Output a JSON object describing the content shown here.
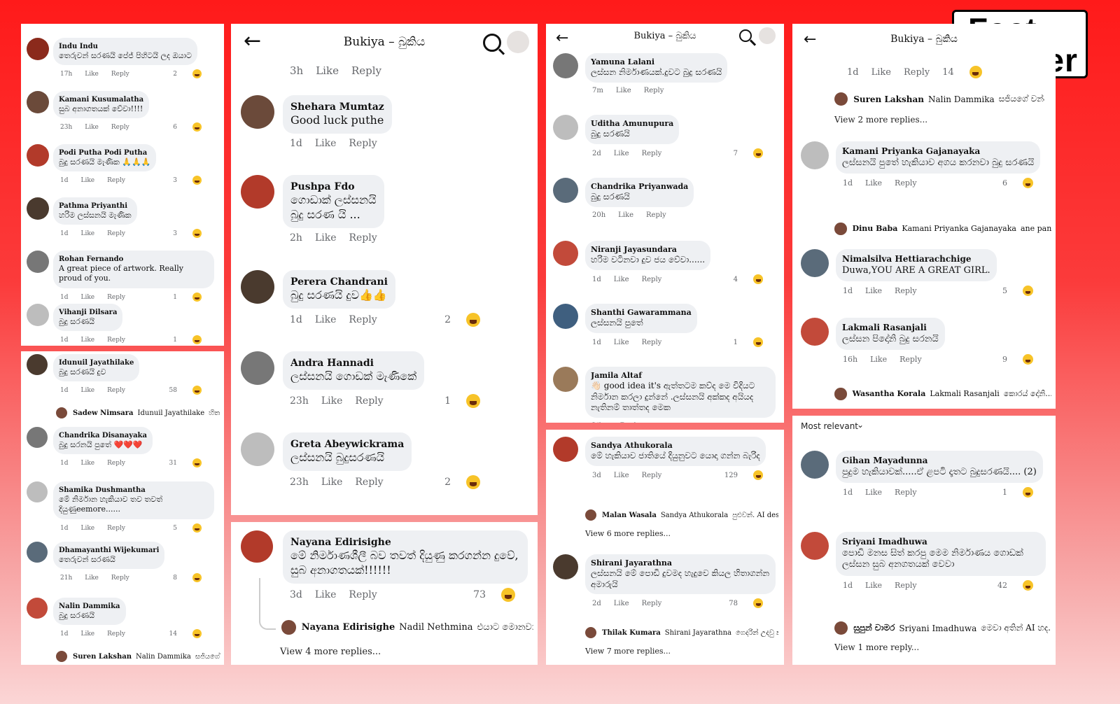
{
  "header_title": "Bukiya – බුකිය",
  "logo": {
    "line1": "Fact",
    "line2": "Seeker"
  },
  "meta": {
    "like": "Like",
    "reply": "Reply"
  },
  "p1": [
    {
      "name": "Indu Indu",
      "text": "තෙරුවන් සරණයි පේජ් පිහිටයි ලද ඔයාට",
      "time": "17h",
      "count": "2"
    },
    {
      "name": "Kamani Kusumalatha",
      "text": "සුබ අනාගතයක් වේවා!!!!",
      "time": "23h",
      "count": "6"
    },
    {
      "name": "Podi Putha Podi Putha",
      "text": "බුදු සරණයි මැණික 🙏🙏🙏",
      "time": "1d",
      "count": "3"
    },
    {
      "name": "Pathma Priyanthi",
      "text": "හරිම ලස්සනයි මැණික",
      "time": "1d",
      "count": "3"
    },
    {
      "name": "Rohan Fernando",
      "text": "A great piece of artwork. Really proud of you.",
      "time": "1d",
      "count": "1"
    },
    {
      "name": "Vihanji Dilsara",
      "text": "බුදු සරණයි",
      "time": "1d",
      "count": "1"
    }
  ],
  "p2": [
    {
      "name": "Idunuil Jayathilake",
      "text": "බුදු සරණයි දුව",
      "time": "1d",
      "count": "58",
      "reply": {
        "who": "Sadew Nimsara",
        "to": "Idunuil Jayathilake",
        "text": "හිත AI වලින් හද..."
      }
    },
    {
      "name": "Chandrika Disanayaka",
      "text": "බුදු සරනයි පුතේ ❤️❤️❤️",
      "time": "1d",
      "count": "31"
    },
    {
      "name": "Shamika Dushmantha",
      "text": "මේ නිර්මාන හැකියාව තව තවත් දියුණුeemore......",
      "time": "1d",
      "count": "5"
    },
    {
      "name": "Dhamayanthi Wijekumari",
      "text": "තෙරුවන් සරණයි",
      "time": "21h",
      "count": "8"
    },
    {
      "name": "Nalin Dammika",
      "text": "බුදු සරණයි",
      "time": "1d",
      "count": "14",
      "reply": {
        "who": "Suren Lakshan",
        "to": "Nalin Dammika",
        "text": "සජියගේ වන්දයක්"
      }
    }
  ],
  "p3": {
    "head_meta": {
      "time": "3h"
    },
    "comments": [
      {
        "name": "Shehara Mumtaz",
        "text": "Good luck puthe",
        "time": "1d",
        "count": ""
      },
      {
        "name": "Pushpa Fdo",
        "text": "ගොඩාක් ලස්සනයි\nබුදු සරණ යි ...",
        "time": "2h",
        "count": ""
      },
      {
        "name": "Perera Chandrani",
        "text": "බුදු සරණයි දුව👍👍",
        "time": "1d",
        "count": "2"
      },
      {
        "name": "Andra Hannadi",
        "text": "ලස්සනයි ගොඩක් මැණිකේ",
        "time": "23h",
        "count": "1"
      },
      {
        "name": "Greta Abeywickrama",
        "text": "ලස්සනයි බුදුසරණයි",
        "time": "23h",
        "count": "2"
      }
    ]
  },
  "p4": {
    "name": "Nayana Edirisighe",
    "text": "මේ නිර්මාණශීලී බව තවත් දියුණු කරගන්න දුවේ, සුබ අනාගතයක්!!!!!!",
    "time": "3d",
    "count": "73",
    "reply": {
      "who": "Nayana Edirisighe",
      "to": "Nadil Nethmina",
      "text": "එයාට මොනවාද..."
    },
    "more": "View 4 more replies..."
  },
  "p5": [
    {
      "name": "Yamuna Lalani",
      "text": "ලස්සන නිර්මාණයක්.දුවට බුදු සරණයි",
      "time": "7m",
      "count": ""
    },
    {
      "name": "Uditha Amunupura",
      "text": "බුදු සරණයි",
      "time": "2d",
      "count": "7"
    },
    {
      "name": "Chandrika Priyanwada",
      "text": "බුදු සරණයි",
      "time": "20h",
      "count": ""
    },
    {
      "name": "Niranji Jayasundara",
      "text": "හරිම වටිනවා දුව ජය වේවා......",
      "time": "1d",
      "count": "4"
    },
    {
      "name": "Shanthi Gawarammana",
      "text": "ලස්සනයි පුතේ",
      "time": "1d",
      "count": "1"
    },
    {
      "name": "Jamila Altaf",
      "text": "👋🏻 good idea it's ඇත්තටම කව්ද මෙ විදියට නිර්මාන කරලා දුන්නේ .ලස්සනයි අක්කද අයියද නැතිනම් තාත්තද මෙක",
      "time": "",
      "count": ""
    }
  ],
  "p6": [
    {
      "name": "Sandya Athukorala",
      "text": "මේ හැකියාව ජාතියේ දියුනුවට යොදා ගන්න බැරිද",
      "time": "3d",
      "count": "129",
      "reply": {
        "who": "Malan Wasala",
        "to": "Sandya Athukorala",
        "text": "පුළුවන්. AI designi..."
      },
      "more": "View 6 more replies..."
    },
    {
      "name": "Shirani Jayarathna",
      "text": "ලස්සනයි මේ පොඩි දුවමද හැදුවෙ කියල හිතාගන්න අමාරුයි",
      "time": "2d",
      "count": "78",
      "reply": {
        "who": "Thilak Kumara",
        "to": "Shirani Jayarathna",
        "text": "ගෙදරින් උදවු කර..."
      },
      "more": "View 7 more replies..."
    }
  ],
  "p7": {
    "top": {
      "time": "1d",
      "count": "14",
      "reply": {
        "who": "Suren Lakshan",
        "to": "Nalin Dammika",
        "text": "සජියගේ වන්දයක්"
      },
      "more": "View 2 more replies..."
    },
    "comments": [
      {
        "name": "Kamani Priyanka Gajanayaka",
        "text": "ලස්සනයි පුතේ හැකියාව අගය කරනවා බුදු සරණයි",
        "time": "1d",
        "count": "6",
        "reply": {
          "who": "Dinu Baba",
          "to": "Kamani Priyanka Gajanayaka",
          "text": "ane pancha"
        }
      },
      {
        "name": "Nimalsilva Hettiarachchige",
        "text": "Duwa,YOU ARE A GREAT GIRL.",
        "time": "1d",
        "count": "5"
      },
      {
        "name": "Lakmali Rasanjali",
        "text": "ලස්සන පිදෝනි බුදු සරනයි",
        "time": "16h",
        "count": "9",
        "reply": {
          "who": "Wasantha Korala",
          "to": "Lakmali Rasanjali",
          "text": "කොරය් දෝනි..."
        }
      }
    ]
  },
  "p8": {
    "filter": "Most relevant",
    "comments": [
      {
        "name": "Gihan Mayadunna",
        "text": "පුදුම හැකියාවක්.....ඒ ළපටි දෑතට බුදුසරණයි.... (2)",
        "time": "1d",
        "count": "1"
      },
      {
        "name": "Sriyani Imadhuwa",
        "text": "පොඩි මනස සිත් කරපු මෙම නිර්මාණය ගොඩක් ලස්සන සුබ අනගතයක් වෙවා",
        "time": "1d",
        "count": "42",
        "reply": {
          "who": "සුපුන් චාමර",
          "to": "Sriyani Imadhuwa",
          "text": "මෙවා අතින් AI හද..."
        },
        "more": "View 1 more reply..."
      }
    ]
  },
  "colors": {
    "bg_top": "#ff1a1a",
    "bubble": "#eef0f3",
    "haha": "#f7c328",
    "heart": "#f0334b",
    "like_blue": "#1877f2"
  }
}
